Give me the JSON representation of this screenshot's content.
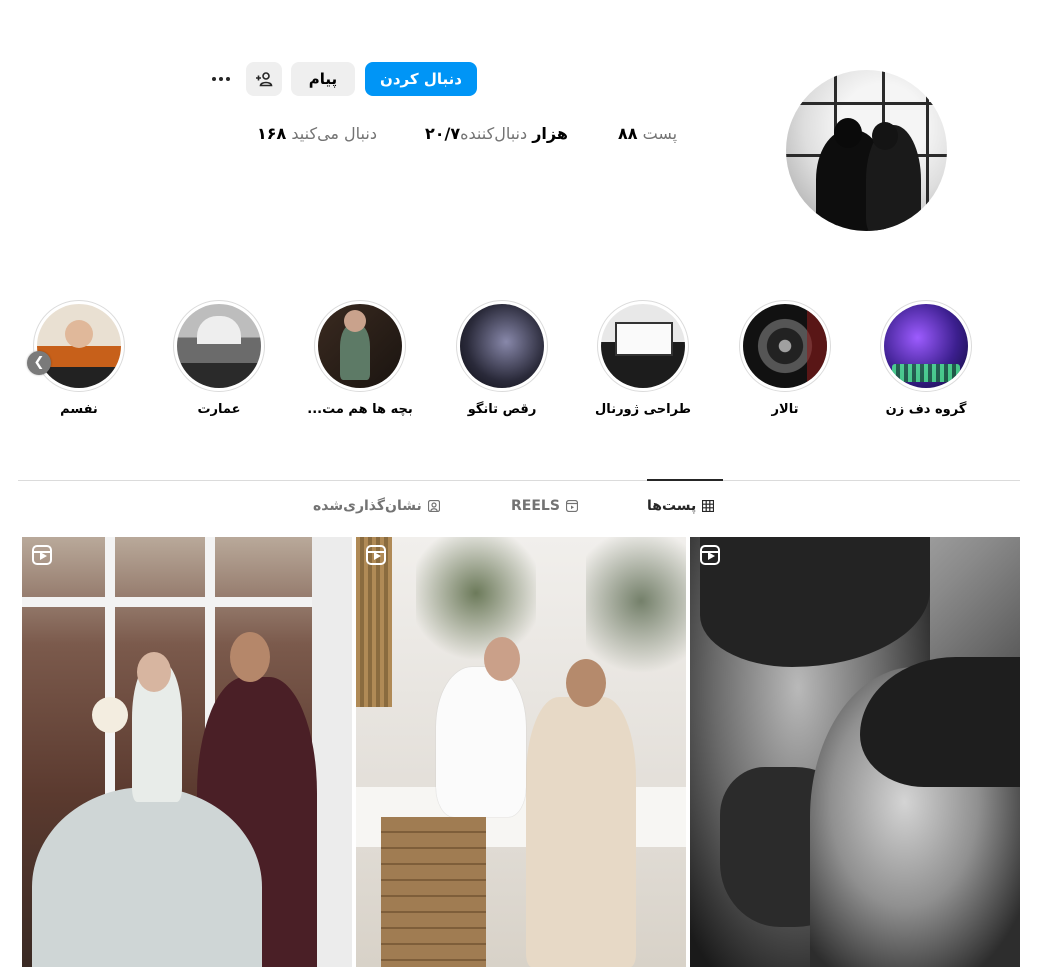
{
  "profile": {
    "follow_label": "دنبال کردن",
    "message_label": "پیام",
    "posts_count": "۸۸",
    "posts_label": "پست",
    "followers_count": "۲۰/۷هزار",
    "followers_label": "دنبال‌کننده",
    "following_count": "۱۶۸",
    "following_label": "دنبال می‌کنید"
  },
  "highlights": [
    {
      "label": "گروه دف زن"
    },
    {
      "label": "تالار"
    },
    {
      "label": "طراحی ژورنال"
    },
    {
      "label": "رقص تانگو"
    },
    {
      "label": "بچه ها هم مت..."
    },
    {
      "label": "عمارت"
    },
    {
      "label": "نفسم"
    }
  ],
  "tabs": {
    "posts": "پست‌ها",
    "reels": "REELS",
    "tagged": "نشان‌گذاری‌شده"
  },
  "colors": {
    "accent": "#0095f6",
    "button_bg": "#efefef",
    "divider": "#dbdbdb"
  }
}
